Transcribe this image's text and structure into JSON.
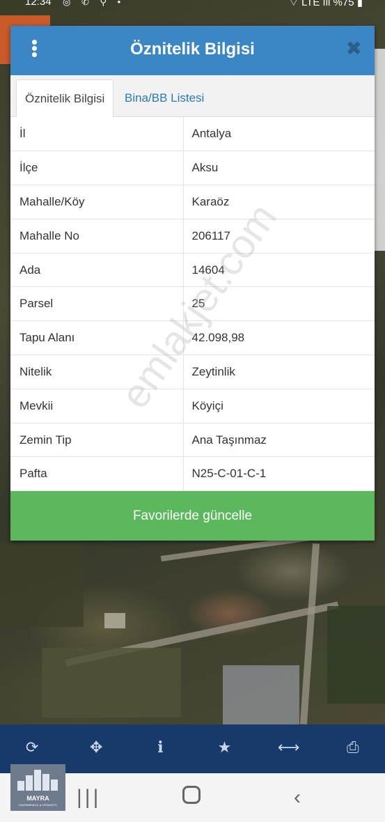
{
  "status_bar": {
    "time": "12:34",
    "left_icons": "◎ ✆ ⚲ •",
    "right": "⌔ LTE ıll %75 ▮"
  },
  "dialog": {
    "title": "Öznitelik Bilgisi",
    "menu_icon": "kebab-icon",
    "close_icon": "✖",
    "tabs": [
      {
        "label": "Öznitelik Bilgisi",
        "active": true
      },
      {
        "label": "Bina/BB Listesi",
        "active": false
      }
    ],
    "rows": [
      {
        "key": "İl",
        "value": "Antalya"
      },
      {
        "key": "İlçe",
        "value": "Aksu"
      },
      {
        "key": "Mahalle/Köy",
        "value": "Karaöz"
      },
      {
        "key": "Mahalle No",
        "value": "206117"
      },
      {
        "key": "Ada",
        "value": "14604"
      },
      {
        "key": "Parsel",
        "value": "25"
      },
      {
        "key": "Tapu Alanı",
        "value": "42.098,98"
      },
      {
        "key": "Nitelik",
        "value": "Zeytinlik"
      },
      {
        "key": "Mevkii",
        "value": "Köyiçi"
      },
      {
        "key": "Zemin Tip",
        "value": "Ana Taşınmaz"
      },
      {
        "key": "Pafta",
        "value": "N25-C-01-C-1"
      }
    ],
    "action_label": "Favorilerde güncelle",
    "action_color": "#5cb85c",
    "header_color": "#3b87c5"
  },
  "watermark": "emlakjet.com",
  "toolbar": {
    "color": "#183a6b",
    "tools": [
      {
        "name": "refresh-icon",
        "glyph": "⟳"
      },
      {
        "name": "locate-icon",
        "glyph": "✥"
      },
      {
        "name": "info-icon",
        "glyph": "i"
      },
      {
        "name": "star-icon",
        "glyph": "★"
      },
      {
        "name": "measure-icon",
        "glyph": "⟷"
      },
      {
        "name": "print-icon",
        "glyph": "⎙"
      }
    ]
  },
  "navbar": {
    "recent": "|||",
    "back": "‹"
  },
  "logo": {
    "name": "MAYRA",
    "sub": "GAYRIMENKUL & OTOMOTIV"
  }
}
